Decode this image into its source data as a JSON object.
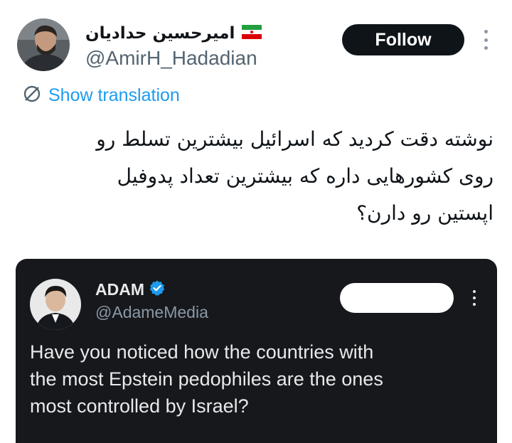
{
  "tweet": {
    "author": {
      "display_name": "امیرحسین حدادیان",
      "handle": "@AmirH_Hadadian",
      "flag_icon": "iran-flag-icon"
    },
    "follow_label": "Follow",
    "translate_label": "Show translation",
    "body_lines": [
      "نوشته دقت کردید که اسرائیل بیشترین تسلط رو",
      "روی کشورهایی داره که بیشترین تعداد پدوفیل",
      "اپستین رو دارن؟"
    ]
  },
  "quoted": {
    "display_name": "ADAM",
    "handle": "@AdameMedia",
    "verified_color": "#1d9bf0",
    "body_lines": [
      "Have you noticed how the countries with",
      "the most Epstein pedophiles are the ones",
      "most controlled by Israel?"
    ]
  },
  "colors": {
    "accent": "#1d9bf0",
    "text_primary": "#0f1419",
    "text_secondary": "#536471",
    "card_bg": "#16181c"
  }
}
